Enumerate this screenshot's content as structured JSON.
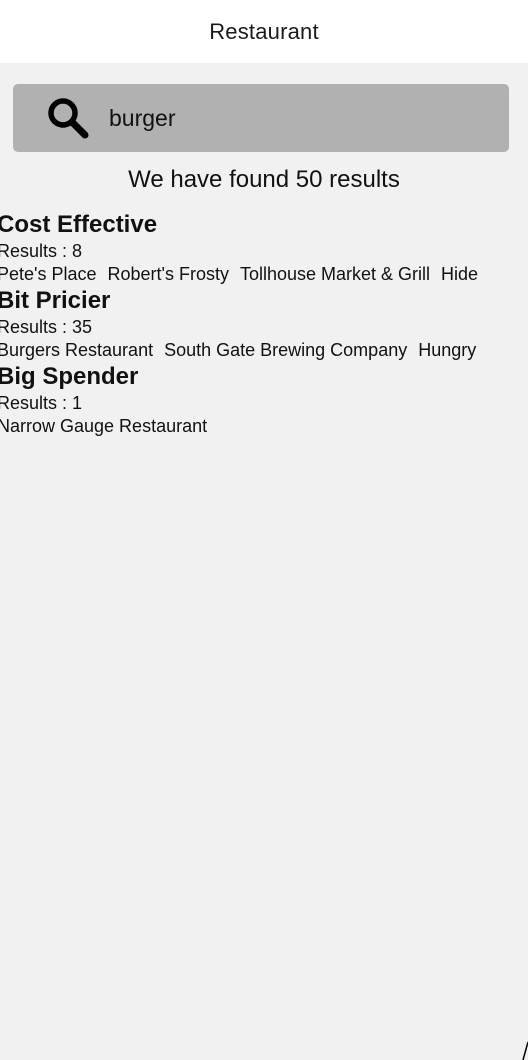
{
  "header": {
    "title": "Restaurant"
  },
  "search": {
    "icon": "search-icon",
    "value": "burger",
    "placeholder": ""
  },
  "summary": "We have found 50 results",
  "groups": [
    {
      "title": "Cost Effective",
      "count_text": "Results : 8",
      "items": [
        "Pete's Place",
        "Robert's Frosty",
        "Tollhouse Market & Grill",
        "Hide"
      ]
    },
    {
      "title": "Bit Pricier",
      "count_text": "Results : 35",
      "items": [
        "Burgers Restaurant",
        "South Gate Brewing Company",
        "Hungry"
      ]
    },
    {
      "title": "Big Spender",
      "count_text": "Results : 1",
      "items": [
        "Narrow Gauge Restaurant"
      ]
    }
  ]
}
